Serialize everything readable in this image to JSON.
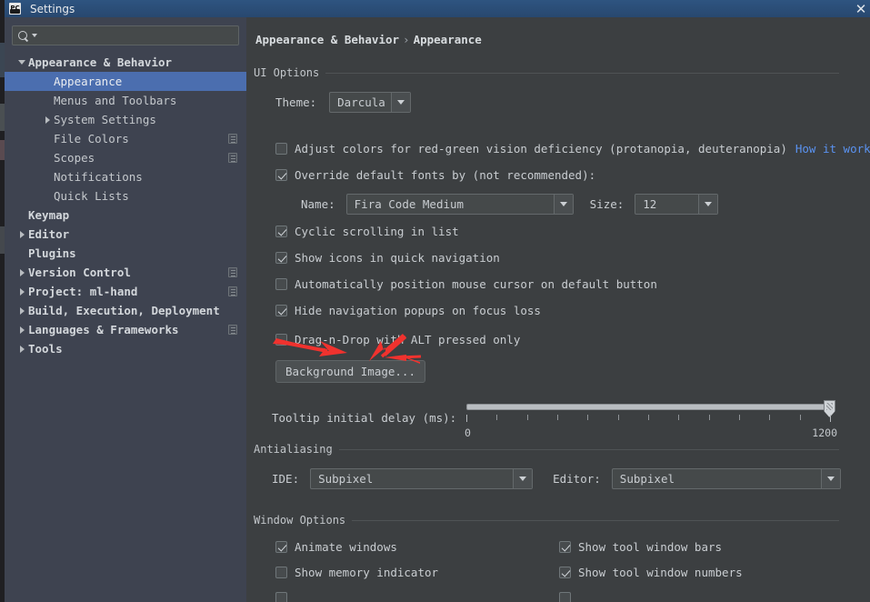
{
  "window": {
    "title": "Settings",
    "app_icon": "pycharm-icon",
    "close_label": "✕"
  },
  "sidebar": {
    "search": {
      "value": "",
      "placeholder": "",
      "icon": "search-icon"
    },
    "items": [
      {
        "label": "Appearance & Behavior",
        "indent": 0,
        "twisty": "down",
        "bold": true,
        "selected": false,
        "config_icon": false
      },
      {
        "label": "Appearance",
        "indent": 1,
        "twisty": "none",
        "bold": false,
        "selected": true,
        "config_icon": false
      },
      {
        "label": "Menus and Toolbars",
        "indent": 1,
        "twisty": "none",
        "bold": false,
        "selected": false,
        "config_icon": false
      },
      {
        "label": "System Settings",
        "indent": 1,
        "twisty": "right",
        "bold": false,
        "selected": false,
        "config_icon": false
      },
      {
        "label": "File Colors",
        "indent": 1,
        "twisty": "none",
        "bold": false,
        "selected": false,
        "config_icon": true
      },
      {
        "label": "Scopes",
        "indent": 1,
        "twisty": "none",
        "bold": false,
        "selected": false,
        "config_icon": true
      },
      {
        "label": "Notifications",
        "indent": 1,
        "twisty": "none",
        "bold": false,
        "selected": false,
        "config_icon": false
      },
      {
        "label": "Quick Lists",
        "indent": 1,
        "twisty": "none",
        "bold": false,
        "selected": false,
        "config_icon": false
      },
      {
        "label": "Keymap",
        "indent": 0,
        "twisty": "none",
        "bold": true,
        "selected": false,
        "config_icon": false
      },
      {
        "label": "Editor",
        "indent": 0,
        "twisty": "right",
        "bold": true,
        "selected": false,
        "config_icon": false
      },
      {
        "label": "Plugins",
        "indent": 0,
        "twisty": "none",
        "bold": true,
        "selected": false,
        "config_icon": false
      },
      {
        "label": "Version Control",
        "indent": 0,
        "twisty": "right",
        "bold": true,
        "selected": false,
        "config_icon": true
      },
      {
        "label": "Project: ml-hand",
        "indent": 0,
        "twisty": "right",
        "bold": true,
        "selected": false,
        "config_icon": true
      },
      {
        "label": "Build, Execution, Deployment",
        "indent": 0,
        "twisty": "right",
        "bold": true,
        "selected": false,
        "config_icon": false
      },
      {
        "label": "Languages & Frameworks",
        "indent": 0,
        "twisty": "right",
        "bold": true,
        "selected": false,
        "config_icon": true
      },
      {
        "label": "Tools",
        "indent": 0,
        "twisty": "right",
        "bold": true,
        "selected": false,
        "config_icon": false
      }
    ]
  },
  "main": {
    "breadcrumb": {
      "parent": "Appearance & Behavior",
      "separator": "›",
      "current": "Appearance"
    },
    "sections": {
      "ui_options": "UI Options",
      "antialiasing": "Antialiasing",
      "window_options": "Window Options"
    },
    "theme": {
      "label": "Theme:",
      "value": "Darcula"
    },
    "checkboxes": {
      "adjust_colors": {
        "label": "Adjust colors for red-green vision deficiency (protanopia, deuteranopia)",
        "checked": false
      },
      "how_it_works": "How it works",
      "override_fonts": {
        "label": "Override default fonts by (not recommended):",
        "checked": true
      },
      "cyclic_scrolling": {
        "label": "Cyclic scrolling in list",
        "checked": true
      },
      "show_icons_quicknav": {
        "label": "Show icons in quick navigation",
        "checked": true
      },
      "auto_position_cursor": {
        "label": "Automatically position mouse cursor on default button",
        "checked": false
      },
      "hide_nav_popups": {
        "label": "Hide navigation popups on focus loss",
        "checked": true
      },
      "drag_n_drop_alt": {
        "label": "Drag-n-Drop with ALT pressed only",
        "checked": false
      }
    },
    "font": {
      "name_label": "Name:",
      "name_value": "Fira Code Medium",
      "size_label": "Size:",
      "size_value": "12"
    },
    "background_image_button": "Background Image...",
    "tooltip_slider": {
      "label": "Tooltip initial delay (ms):",
      "min_label": "0",
      "max_label": "1200",
      "min": 0,
      "max": 1200,
      "value": 1200,
      "ticks": 13
    },
    "antialiasing": {
      "ide_label": "IDE:",
      "ide_value": "Subpixel",
      "editor_label": "Editor:",
      "editor_value": "Subpixel"
    },
    "window_options": {
      "animate_windows": {
        "label": "Animate windows",
        "checked": true
      },
      "show_memory_indicator": {
        "label": "Show memory indicator",
        "checked": false
      },
      "show_tool_window_bars": {
        "label": "Show tool window bars",
        "checked": true
      },
      "show_tool_window_numbers": {
        "label": "Show tool window numbers",
        "checked": true
      }
    }
  },
  "annotations": {
    "arrow_color": "#f0322e",
    "arrow_count": 3,
    "target": "background-image-button"
  },
  "colors": {
    "titlebar": "#2e5480",
    "sidebar_bg": "#3e4350",
    "main_bg": "#3c3f41",
    "selection": "#4b6eaf",
    "link": "#5a92f0",
    "text": "#c9cdd1"
  }
}
